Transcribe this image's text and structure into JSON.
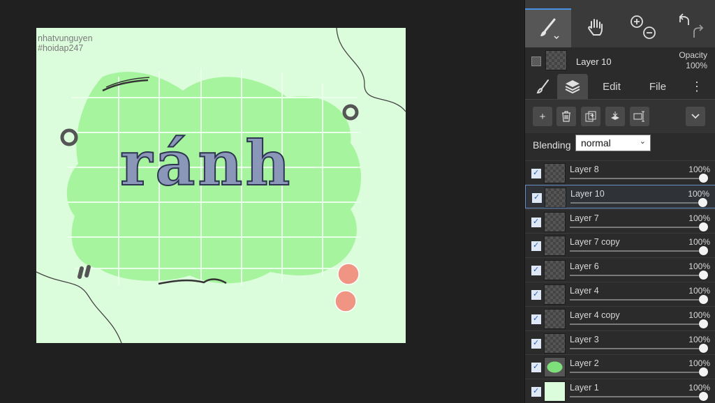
{
  "canvas": {
    "watermark_line1": "nhatvunguyen",
    "watermark_line2": "#hoidap247",
    "artwork_text": "ránh",
    "colors": {
      "background": "#dcfddc",
      "blob": "#a6f59e",
      "grid": "#e9ffe9",
      "text": "#8b97b8",
      "circles": "#f09484"
    }
  },
  "toolbar": {
    "brush_icon": "brush-icon",
    "hand_icon": "hand-icon",
    "zoom_in_icon": "zoom-in-icon",
    "zoom_out_icon": "zoom-out-icon",
    "undo_icon": "undo-icon",
    "redo_icon": "redo-icon"
  },
  "current_layer": {
    "name": "Layer 10",
    "opacity_label": "Opacity",
    "opacity_value": "100%"
  },
  "tabs": {
    "brush": "brush-tab-icon",
    "layers": "layers-tab-icon",
    "edit": "Edit",
    "file": "File",
    "more": "⋮"
  },
  "layer_tools": {
    "add": "+",
    "delete": "delete-icon",
    "duplicate": "duplicate-icon",
    "merge": "merge-down-icon",
    "transform": "transform-icon",
    "expand": "chevron-down-icon"
  },
  "blending": {
    "label": "Blending",
    "value": "normal"
  },
  "layers": [
    {
      "name": "Layer 8",
      "opacity": "100%",
      "checked": true,
      "selected": false
    },
    {
      "name": "Layer 10",
      "opacity": "100%",
      "checked": true,
      "selected": true
    },
    {
      "name": "Layer 7",
      "opacity": "100%",
      "checked": true,
      "selected": false
    },
    {
      "name": "Layer 7 copy",
      "opacity": "100%",
      "checked": true,
      "selected": false
    },
    {
      "name": "Layer 6",
      "opacity": "100%",
      "checked": true,
      "selected": false
    },
    {
      "name": "Layer 4",
      "opacity": "100%",
      "checked": true,
      "selected": false
    },
    {
      "name": "Layer 4 copy",
      "opacity": "100%",
      "checked": true,
      "selected": false
    },
    {
      "name": "Layer 3",
      "opacity": "100%",
      "checked": true,
      "selected": false
    },
    {
      "name": "Layer 2",
      "opacity": "100%",
      "checked": true,
      "selected": false
    },
    {
      "name": "Layer 1",
      "opacity": "100%",
      "checked": true,
      "selected": false
    }
  ]
}
